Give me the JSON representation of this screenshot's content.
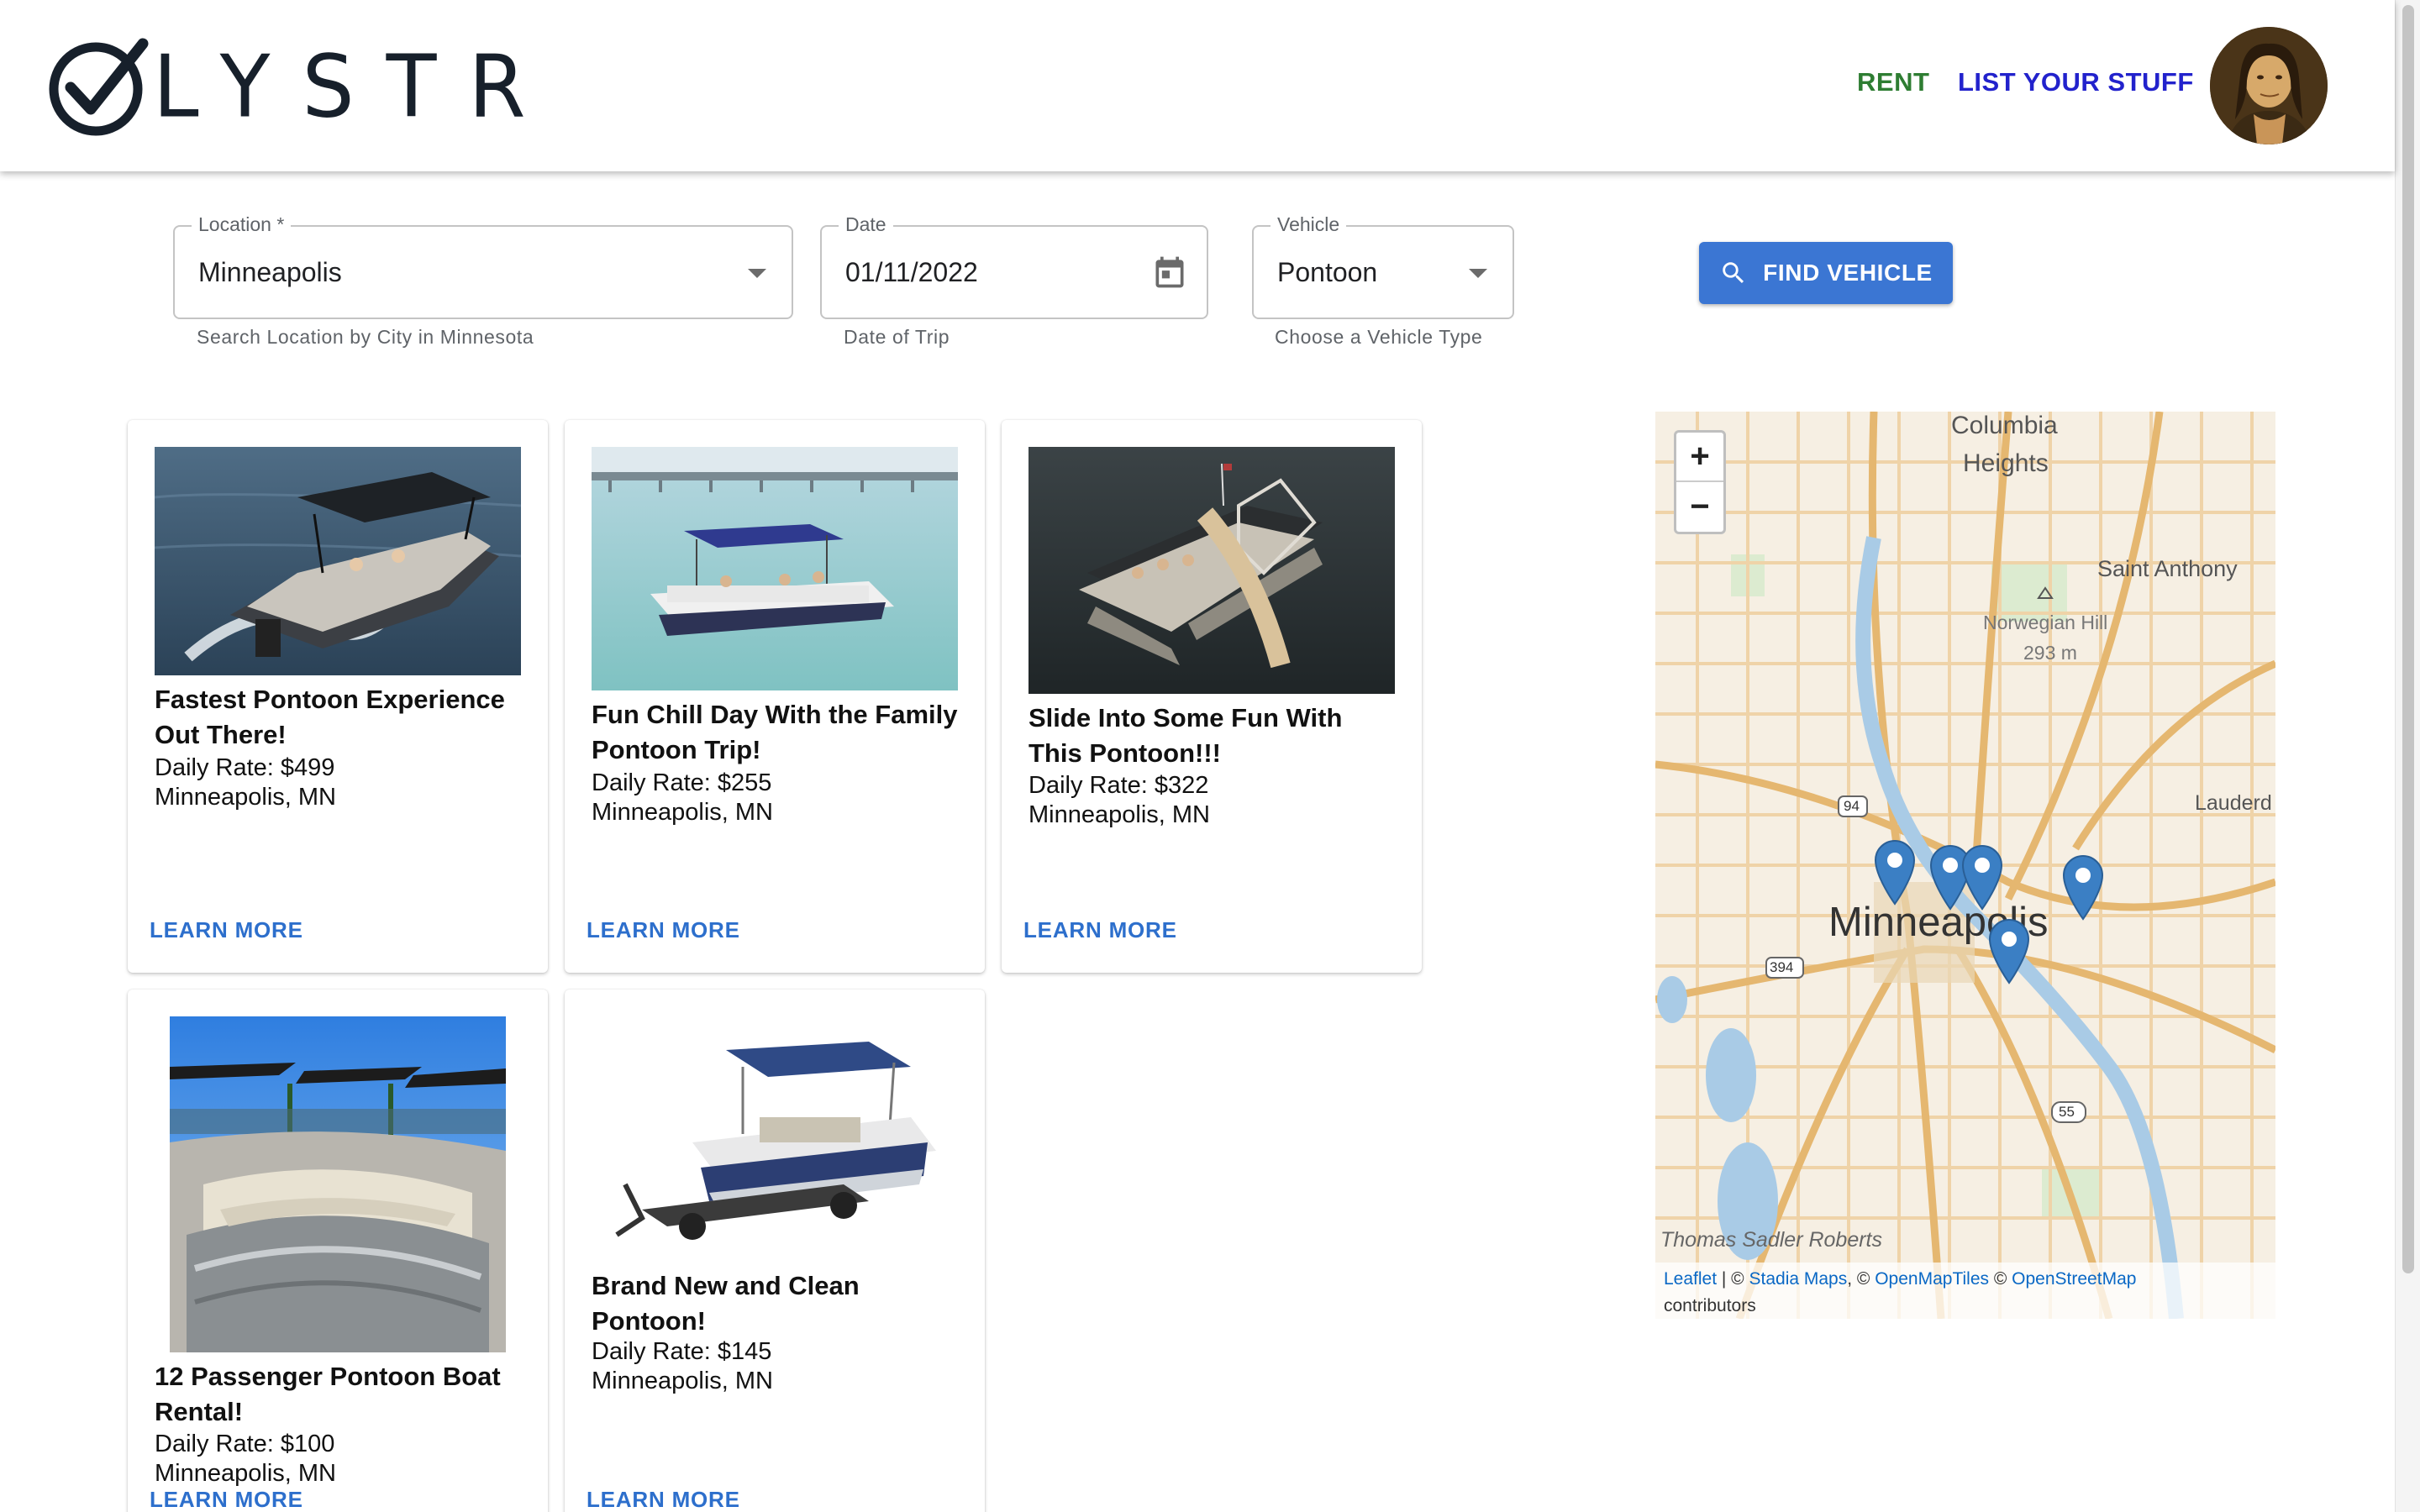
{
  "header": {
    "logo_text": "LYSTR",
    "nav_rent": "RENT",
    "nav_list": "LIST YOUR STUFF"
  },
  "search": {
    "location": {
      "legend": "Location *",
      "value": "Minneapolis",
      "helper": "Search Location by City in Minnesota"
    },
    "date": {
      "legend": "Date",
      "value": "01/11/2022",
      "helper": "Date of Trip"
    },
    "vehicle": {
      "legend": "Vehicle",
      "value": "Pontoon",
      "helper": "Choose a Vehicle Type"
    },
    "button": "FIND VEHICLE"
  },
  "listings": [
    {
      "title": "Fastest Pontoon Experience Out There!",
      "rate": "Daily Rate: $499",
      "location": "Minneapolis, MN",
      "link": "LEARN MORE"
    },
    {
      "title": "Fun Chill Day With the Family Pontoon Trip!",
      "rate": "Daily Rate: $255",
      "location": "Minneapolis, MN",
      "link": "LEARN MORE"
    },
    {
      "title": "Slide Into Some Fun With This Pontoon!!!",
      "rate": "Daily Rate: $322",
      "location": "Minneapolis, MN",
      "link": "LEARN MORE"
    },
    {
      "title": "12 Passenger Pontoon Boat Rental!",
      "rate": "Daily Rate: $100",
      "location": "Minneapolis, MN",
      "link": "LEARN MORE"
    },
    {
      "title": "Brand New and Clean Pontoon!",
      "rate": "Daily Rate: $145",
      "location": "Minneapolis, MN",
      "link": "LEARN MORE"
    }
  ],
  "map": {
    "zoom_in": "+",
    "zoom_out": "−",
    "labels": {
      "columbia": "Columbia",
      "heights": "Heights",
      "saint_anthony": "Saint Anthony",
      "norwegian_hill": "Norwegian Hill",
      "elevation": "293 m",
      "lauderdale": "Lauderd",
      "minneapolis": "Minneapolis",
      "thomas": "Thomas Sadler Roberts",
      "hwy94": "94",
      "hwy394": "394",
      "hwy55": "55"
    },
    "attribution": {
      "leaflet": "Leaflet",
      "sep1": " | © ",
      "stadia": "Stadia Maps",
      "sep2": ", © ",
      "openmaptiles": "OpenMapTiles",
      "sep3": " © ",
      "osm": "OpenStreetMap",
      "contributors": "contributors"
    }
  },
  "colors": {
    "rent": "#2e7d32",
    "list": "#2222cc",
    "button": "#3b76d3",
    "link": "#2d6fcc",
    "pin": "#3b7fc4"
  }
}
